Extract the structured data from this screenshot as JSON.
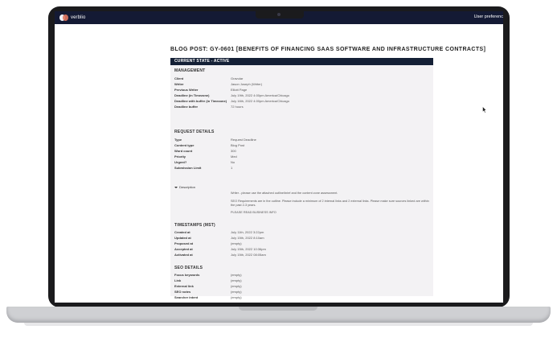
{
  "app": {
    "brand": "verblio",
    "user_preferences": "User preferenc"
  },
  "page": {
    "title": "BLOG POST: GY-0601 [BENEFITS OF FINANCING SAAS SOFTWARE AND INFRASTRUCTURE CONTRACTS]"
  },
  "card": {
    "header": "CURRENT STATE - ACTIVE"
  },
  "management": {
    "title": "MANAGEMENT",
    "rows": [
      {
        "label": "Client",
        "value": "Gravular"
      },
      {
        "label": "Writer",
        "value": "Jason Joseph (Writer)"
      },
      {
        "label": "Previous Writer",
        "value": "Elliott Page"
      },
      {
        "label": "Deadline (in Timezone)",
        "value": "July 19th, 2022 4:00pm America/Chicago"
      },
      {
        "label": "Deadline with buffer (in Timezone)",
        "value": "July 16th, 2022 4:00pm America/Chicago"
      },
      {
        "label": "Deadline buffer",
        "value": "72 hours"
      }
    ]
  },
  "request_details": {
    "title": "REQUEST DETAILS",
    "rows": [
      {
        "label": "Type",
        "value": "Request Deadline"
      },
      {
        "label": "Content type",
        "value": "Blog Post"
      },
      {
        "label": "Word count",
        "value": "300"
      },
      {
        "label": "Priority",
        "value": "Med"
      },
      {
        "label": "Urgent?",
        "value": "No"
      },
      {
        "label": "Submission Limit",
        "value": "1"
      }
    ],
    "description_label": "Description",
    "description_lines": [
      "Writer - please use the attached outline/brief and the content zone assessment.",
      "SEO Requirements are in the outline. Please include a minimum of 2 internal links and 2 external links. Please make sure sources linked are within the past 2-3 years.",
      "PLEASE READ BUSINESS INFO"
    ]
  },
  "timestamps": {
    "title": "TIMESTAMPS (MST)",
    "rows": [
      {
        "label": "Created at",
        "value": "July 11th, 2022 3:22pm"
      },
      {
        "label": "Updated at",
        "value": "July 15th, 2022 8:10am"
      },
      {
        "label": "Proposed at",
        "value": "(empty)"
      },
      {
        "label": "Accepted at",
        "value": "July 15th, 2022 10:36pm"
      },
      {
        "label": "Activated at",
        "value": "July 15th, 2022 08:05am"
      }
    ]
  },
  "seo_details": {
    "title": "SEO DETAILS",
    "rows": [
      {
        "label": "Focus keywords",
        "value": "(empty)"
      },
      {
        "label": "Link",
        "value": "(empty)"
      },
      {
        "label": "External link",
        "value": "(empty)"
      },
      {
        "label": "SEO notes",
        "value": "(empty)"
      },
      {
        "label": "Searcher intent",
        "value": "(empty)"
      }
    ]
  },
  "colors": {
    "app_bar": "#141a34",
    "card_header": "#142036",
    "card_bg": "#f3f2f4"
  },
  "icons": [
    "logo-icon",
    "chevron-down-icon",
    "mouse-pointer-icon"
  ]
}
